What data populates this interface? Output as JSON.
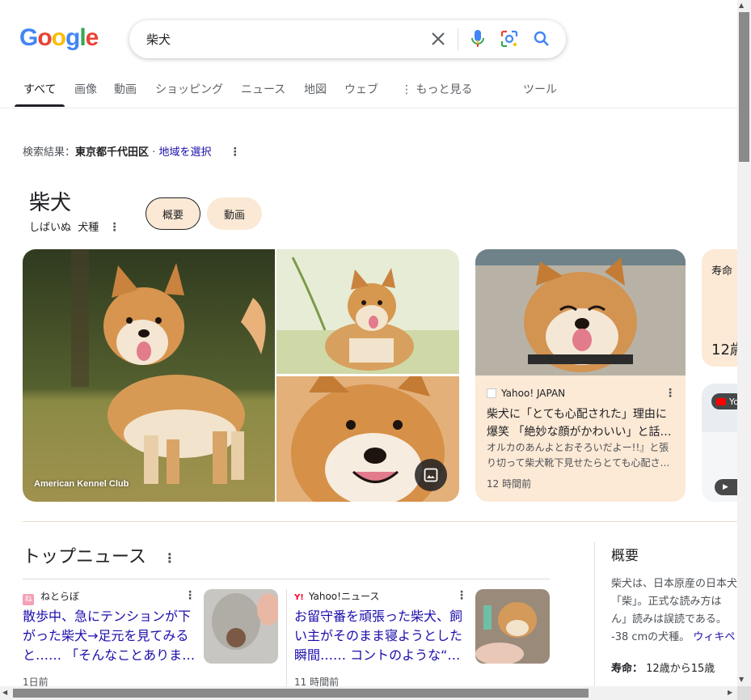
{
  "logo": {
    "letters": [
      "G",
      "o",
      "o",
      "g",
      "l",
      "e"
    ]
  },
  "search": {
    "query": "柴犬"
  },
  "tabs": [
    {
      "label": "すべて"
    },
    {
      "label": "画像"
    },
    {
      "label": "動画"
    },
    {
      "label": "ショッピング"
    },
    {
      "label": "ニュース"
    },
    {
      "label": "地図"
    },
    {
      "label": "ウェブ"
    },
    {
      "label": "もっと見る"
    },
    {
      "label": "ツール"
    }
  ],
  "location": {
    "prefix": "検索結果：",
    "place": "東京都千代田区",
    "sep": " · ",
    "link": "地域を選択"
  },
  "kp": {
    "title": "柴犬",
    "reading": "しばいぬ",
    "category": "犬種",
    "chips": [
      {
        "label": "概要"
      },
      {
        "label": "動画"
      }
    ],
    "main_image_caption": "American Kennel Club"
  },
  "article_card": {
    "source": "Yahoo! JAPAN",
    "title": "柴犬に「とても心配された」理由に爆笑 「絶妙な顔がかわいい」と話…",
    "snippet": "オルカのあんよとおそろいだよー!!』と張り切って柴犬靴下見せたらとても心配さ…",
    "time": "12 時間前"
  },
  "lifespan_card": {
    "label": "寿命",
    "value_partial": "12歳"
  },
  "video_card": {
    "source_partial": "Yo"
  },
  "top_news": {
    "title": "トップニュース",
    "items": [
      {
        "source": "ねとらぼ",
        "title": "散歩中、急にテンションが下がった柴犬→足元を見てみると…… 「そんなことありま…",
        "time": "1日前"
      },
      {
        "source": "Yahoo!ニュース",
        "title": "お留守番を頑張った柴犬、飼い主がそのまま寝ようとした瞬間…… コントのような“…",
        "time": "11 時間前"
      }
    ]
  },
  "overview": {
    "title": "概要",
    "text_lines": [
      "柴犬は、日本原産の日本犬",
      "「柴」。正式な読み方は",
      "ん」読みは誤読である。",
      "-38 cmの犬種。"
    ],
    "wiki_link": "ウィキペ",
    "lifespan_label": "寿命：",
    "lifespan_value": "12歳から15歳"
  },
  "colors": {
    "accent_link": "#1a0dab",
    "card_bg": "#fce9d6",
    "chip_bg": "#fbe9d5"
  }
}
